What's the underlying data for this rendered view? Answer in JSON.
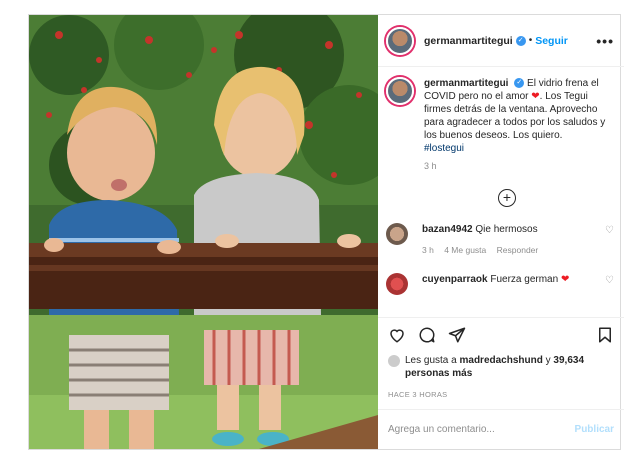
{
  "header": {
    "username": "germanmartitegui",
    "follow_label": "Seguir",
    "dot": "•",
    "more": "•••"
  },
  "caption": {
    "username": "germanmartitegui",
    "text_1": "El vidrio frena el COVID pero no el amor",
    "text_2": ". Los Tegui firmes detrás de la ventana. Aprovecho para agradecer a todos por los saludos y los buenos deseos. Los quiero.",
    "hashtag": "#lostegui",
    "time": "3 h"
  },
  "comments": [
    {
      "username": "bazan4942",
      "text": "Qie hermosos",
      "time": "3 h",
      "likes": "4 Me gusta",
      "reply": "Responder"
    },
    {
      "username": "cuyenparraok",
      "text": "Fuerza german",
      "time": "",
      "likes": "",
      "reply": ""
    }
  ],
  "likes": {
    "prefix": "Les gusta a",
    "user": "madredachshund",
    "connector": "y",
    "count": "39,634 personas más"
  },
  "ago": "HACE 3 HORAS",
  "add_comment": {
    "placeholder": "Agrega un comentario...",
    "publish": "Publicar"
  },
  "colors": {
    "accent": "#0095f6",
    "heart": "#ed1c24",
    "hashtag": "#00376b"
  }
}
